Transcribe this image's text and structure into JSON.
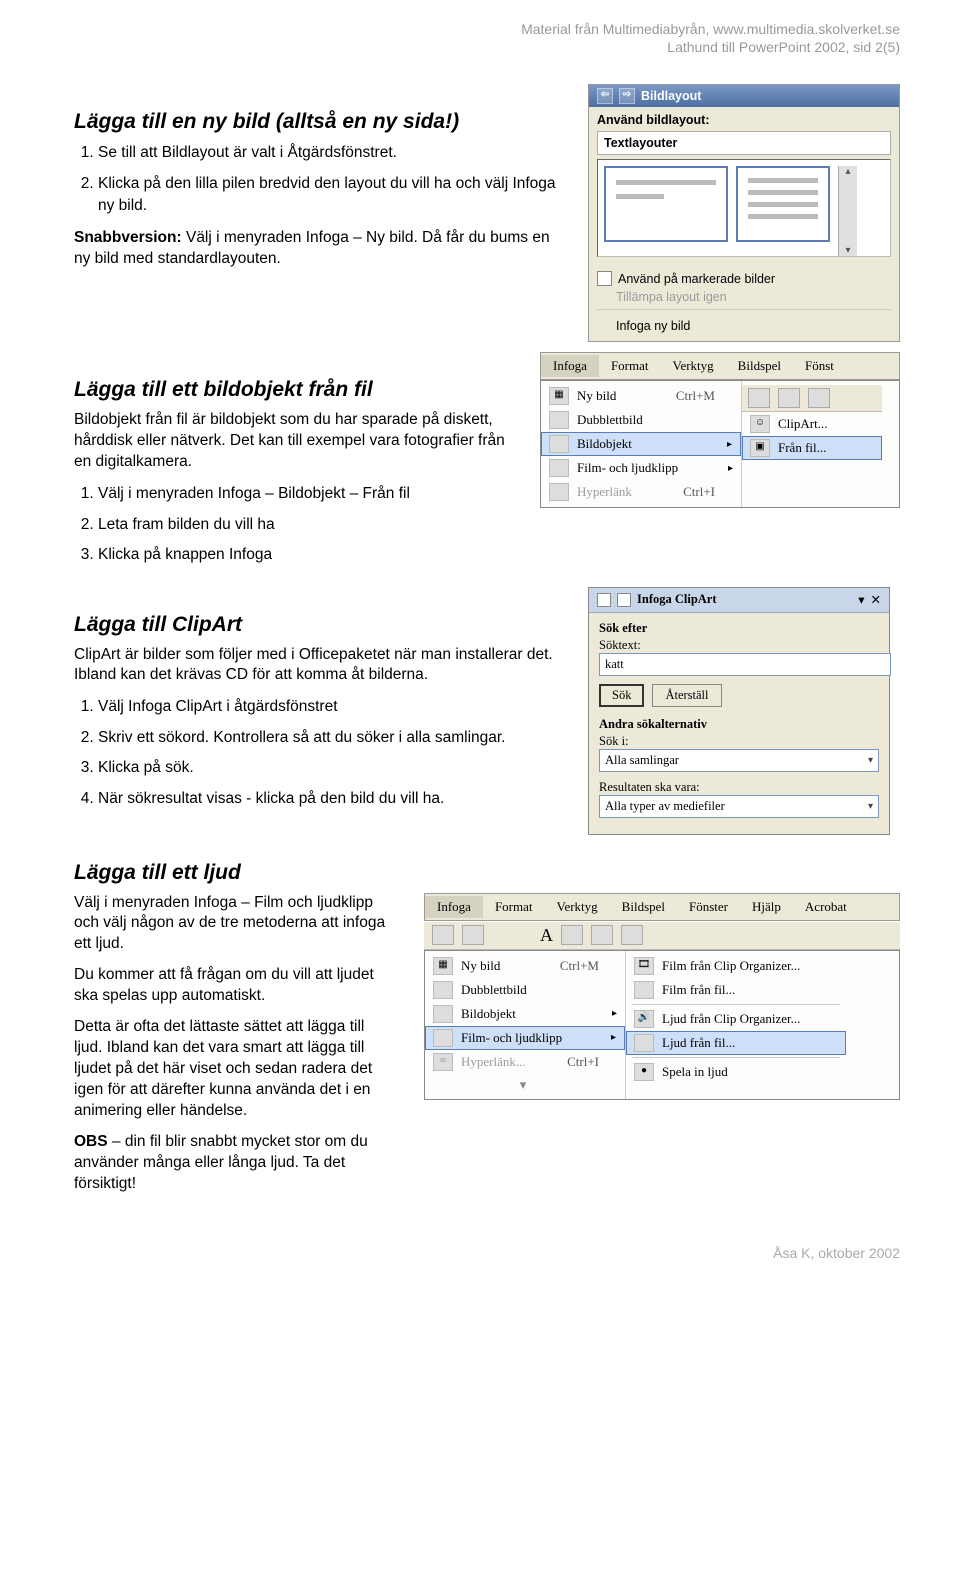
{
  "header": {
    "line1": "Material från Multimediabyrån, www.multimedia.skolverket.se",
    "line2": "Lathund till PowerPoint 2002, sid 2(5)"
  },
  "s1": {
    "title": "Lägga till en ny bild (alltså en ny sida!)",
    "items": [
      "Se till att Bildlayout är valt i Åtgärdsfönstret.",
      "Klicka på den lilla pilen bredvid den layout du vill ha och välj Infoga ny bild."
    ],
    "snabb_label": "Snabbversion:",
    "snabb_text": " Välj i menyraden Infoga – Ny bild. Då får du bums en ny bild med standardlayouten."
  },
  "bildlayout": {
    "title": "Bildlayout",
    "use": "Använd bildlayout:",
    "section": "Textlayouter",
    "opt1": "Använd på markerade bilder",
    "opt2_disabled": "Tillämpa layout igen",
    "opt3": "Infoga ny bild"
  },
  "s2": {
    "title": "Lägga till ett bildobjekt från fil",
    "intro": "Bildobjekt från fil är bildobjekt som du har sparade på diskett, hårddisk eller nätverk. Det kan till exempel vara fotografier från en digitalkamera.",
    "items": [
      "Välj i menyraden Infoga – Bildobjekt – Från fil",
      "Leta fram bilden du vill ha",
      "Klicka på knappen Infoga"
    ]
  },
  "menu1": {
    "bar": [
      "Infoga",
      "Format",
      "Verktyg",
      "Bildspel",
      "Fönst"
    ],
    "col1": [
      {
        "label": "Ny bild",
        "short": "Ctrl+M"
      },
      {
        "label": "Dubblettbild"
      },
      {
        "label": "Bildobjekt",
        "hl": true,
        "arrow": true
      },
      {
        "label": "Film- och ljudklipp",
        "arrow": true
      },
      {
        "label": "Hyperlänk",
        "short": "Ctrl+I",
        "grey": true
      }
    ],
    "col2": [
      {
        "label": "ClipArt..."
      },
      {
        "label": "Från fil...",
        "hl": true
      }
    ]
  },
  "s3": {
    "title": "Lägga till ClipArt",
    "intro": "ClipArt är bilder som följer med i Officepaketet när man installerar det. Ibland kan det krävas CD för att komma åt bilderna.",
    "items": [
      "Välj Infoga ClipArt i åtgärdsfönstret",
      "Skriv ett sökord. Kontrollera så att du söker i alla samlingar.",
      "Klicka på sök.",
      "När sökresultat visas - klicka på den bild du vill ha."
    ]
  },
  "clipart": {
    "title": "Infoga ClipArt",
    "sok_efter": "Sök efter",
    "soktext": "Söktext:",
    "value": "katt",
    "btn_sok": "Sök",
    "btn_reset": "Återställ",
    "andra": "Andra sökalternativ",
    "soki": "Sök i:",
    "sel1": "Alla samlingar",
    "res": "Resultaten ska vara:",
    "sel2": "Alla typer av mediefiler"
  },
  "s4": {
    "title": "Lägga till ett ljud",
    "p1": "Välj i menyraden Infoga – Film och ljudklipp och välj någon av de tre metoderna att infoga ett ljud.",
    "p2": "Du kommer att få frågan om du vill att ljudet ska spelas upp automatiskt.",
    "p3": "Detta är ofta det lättaste sättet att lägga till ljud. Ibland kan det vara smart att lägga till ljudet på det här viset och sedan radera det igen för att därefter kunna använda det i en animering eller händelse.",
    "obs_label": "OBS",
    "obs_text": " – din fil blir snabbt mycket stor om du använder många eller långa ljud. Ta det försiktigt!"
  },
  "menu2": {
    "bar": [
      "Infoga",
      "Format",
      "Verktyg",
      "Bildspel",
      "Fönster",
      "Hjälp",
      "Acrobat"
    ],
    "col1": [
      {
        "label": "Ny bild",
        "short": "Ctrl+M"
      },
      {
        "label": "Dubblettbild"
      },
      {
        "label": "Bildobjekt",
        "arrow": true
      },
      {
        "label": "Film- och ljudklipp",
        "hl": true,
        "arrow": true
      },
      {
        "label": "Hyperlänk...",
        "short": "Ctrl+I",
        "grey": true
      },
      {
        "label": "expand",
        "center": true
      }
    ],
    "col2": [
      {
        "label": "Film från Clip Organizer..."
      },
      {
        "label": "Film från fil..."
      },
      {
        "label": "Ljud från Clip Organizer..."
      },
      {
        "label": "Ljud från fil...",
        "hl": true
      },
      {
        "label": "Spela in ljud"
      }
    ]
  },
  "toolbar_sample": "A",
  "footer": "Åsa K, oktober 2002"
}
